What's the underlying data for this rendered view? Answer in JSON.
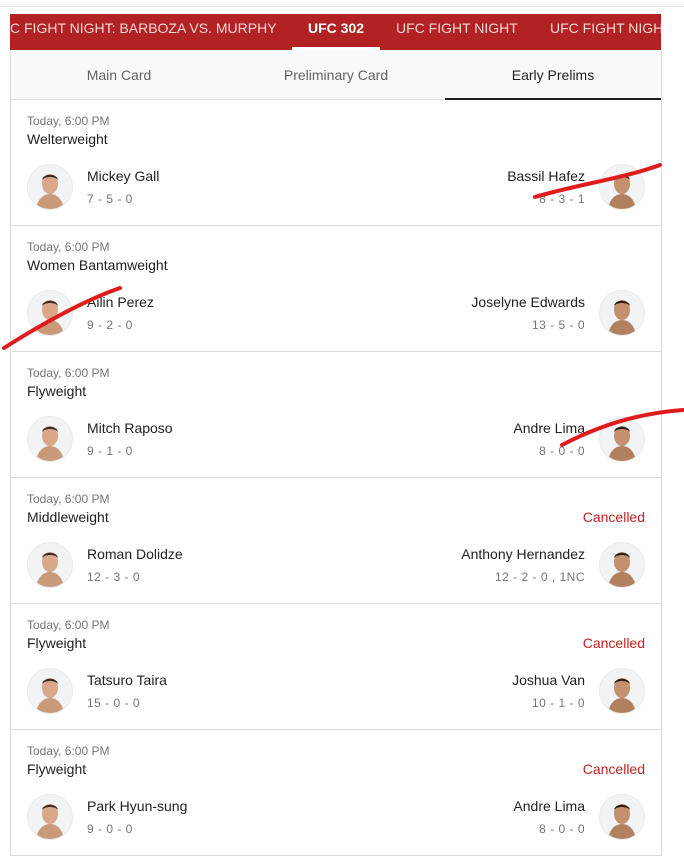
{
  "event_tabs": [
    {
      "label": "C FIGHT NIGHT: BARBOZA VS. MURPHY"
    },
    {
      "label": "UFC 302"
    },
    {
      "label": "UFC FIGHT NIGHT"
    },
    {
      "label": "UFC FIGHT NIGH"
    }
  ],
  "subtabs": [
    {
      "label": "Main Card"
    },
    {
      "label": "Preliminary Card"
    },
    {
      "label": "Early Prelims"
    }
  ],
  "fights": [
    {
      "time": "Today, 6:00 PM",
      "weight": "Welterweight",
      "status": "",
      "left": {
        "name": "Mickey Gall",
        "record": "7 - 5 - 0"
      },
      "right": {
        "name": "Bassil Hafez",
        "record": "8 - 3 - 1"
      }
    },
    {
      "time": "Today, 6:00 PM",
      "weight": "Women Bantamweight",
      "status": "",
      "left": {
        "name": "Ailin Perez",
        "record": "9 - 2 - 0"
      },
      "right": {
        "name": "Joselyne Edwards",
        "record": "13 - 5 - 0"
      }
    },
    {
      "time": "Today, 6:00 PM",
      "weight": "Flyweight",
      "status": "",
      "left": {
        "name": "Mitch Raposo",
        "record": "9 - 1 - 0"
      },
      "right": {
        "name": "Andre Lima",
        "record": "8 - 0 - 0"
      }
    },
    {
      "time": "Today, 6:00 PM",
      "weight": "Middleweight",
      "status": "Cancelled",
      "left": {
        "name": "Roman Dolidze",
        "record": "12 - 3 - 0"
      },
      "right": {
        "name": "Anthony Hernandez",
        "record": "12 - 2 - 0 , 1NC"
      }
    },
    {
      "time": "Today, 6:00 PM",
      "weight": "Flyweight",
      "status": "Cancelled",
      "left": {
        "name": "Tatsuro Taira",
        "record": "15 - 0 - 0"
      },
      "right": {
        "name": "Joshua Van",
        "record": "10 - 1 - 0"
      }
    },
    {
      "time": "Today, 6:00 PM",
      "weight": "Flyweight",
      "status": "Cancelled",
      "left": {
        "name": "Park Hyun-sung",
        "record": "9 - 0 - 0"
      },
      "right": {
        "name": "Andre Lima",
        "record": "8 - 0 - 0"
      }
    }
  ],
  "colors": {
    "topbar": "#b22222",
    "cancelled": "#c5221f",
    "annotation": "#e01b1b"
  }
}
